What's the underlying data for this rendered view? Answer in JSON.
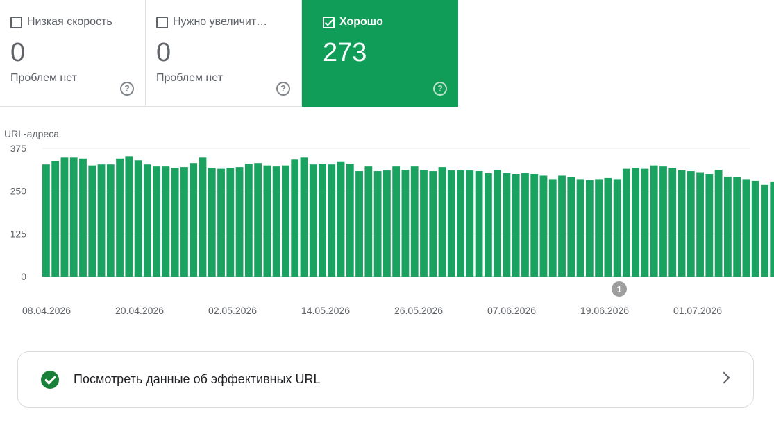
{
  "cards": [
    {
      "label": "Низкая скорость",
      "count": "0",
      "sub": "Проблем нет",
      "checked": false
    },
    {
      "label": "Нужно увеличит…",
      "count": "0",
      "sub": "Проблем нет",
      "checked": false
    },
    {
      "label": "Хорошо",
      "count": "273",
      "sub": "",
      "checked": true
    }
  ],
  "colors": {
    "good": "#0f9d58",
    "bar": "#1aa260",
    "grid": "#e8eaed"
  },
  "chart_data": {
    "type": "bar",
    "ylabel": "URL-адреса",
    "ylim": [
      0,
      375
    ],
    "yticks": [
      "375",
      "250",
      "125",
      "0"
    ],
    "xtick_labels": [
      "08.04.2026",
      "20.04.2026",
      "02.05.2026",
      "14.05.2026",
      "26.05.2026",
      "07.06.2026",
      "19.06.2026",
      "01.07.2026"
    ],
    "series": [
      {
        "values": [
          328,
          338,
          348,
          348,
          345,
          325,
          328,
          328,
          345,
          352,
          340,
          328,
          322,
          322,
          318,
          320,
          332,
          348,
          318,
          315,
          318,
          320,
          330,
          332,
          325,
          322,
          325,
          342,
          348,
          328,
          330,
          328,
          335,
          330,
          308,
          322,
          308,
          310,
          322,
          312,
          322,
          312,
          308,
          320,
          310,
          310,
          310,
          308,
          302,
          312,
          302,
          300,
          302,
          300,
          295,
          285,
          295,
          290,
          285,
          282,
          285,
          288,
          285,
          315,
          318,
          315,
          325,
          322,
          318,
          312,
          308,
          305,
          300,
          312,
          292,
          290,
          285,
          280,
          268,
          278,
          285,
          285,
          282,
          280,
          282,
          285,
          285,
          285,
          285,
          278,
          273
        ]
      }
    ],
    "annotation": "1"
  },
  "link": {
    "label": "Посмотреть данные об эффективных URL"
  }
}
